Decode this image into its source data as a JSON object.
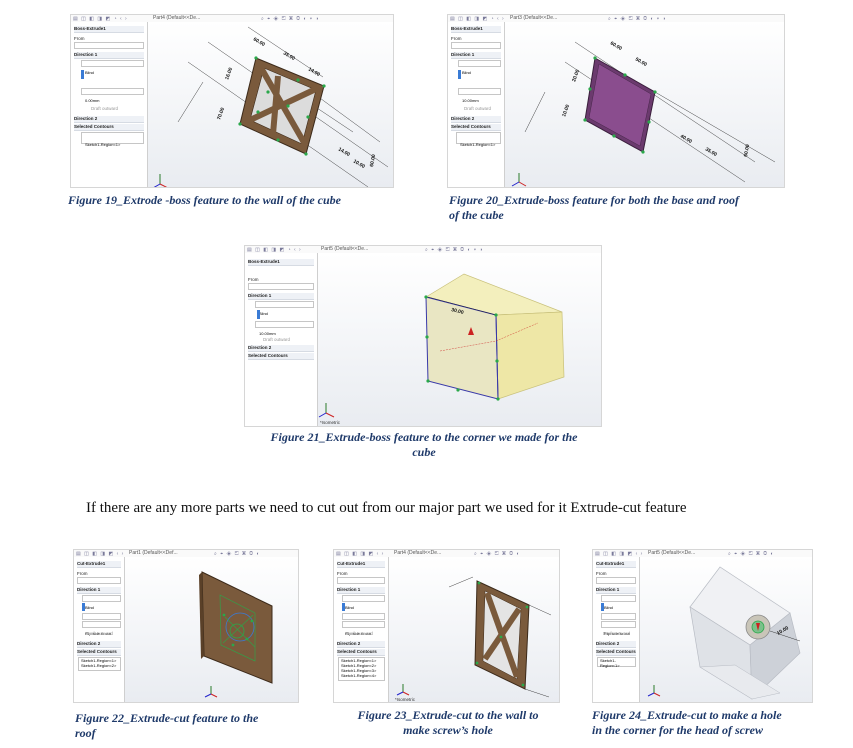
{
  "figures": {
    "f19": {
      "caption": "Figure 19_Extrode -boss feature to the wall of the cube",
      "window_title": "Part4 (Default<<De...",
      "panel_title": "Boss-Extrude1",
      "labels": [
        "From",
        "Sketch Plane",
        "Direction 1",
        "Blind",
        "0.00mm",
        "Draft outward",
        "Direction 2",
        "Selected Contours",
        "Sketch1-Region<1>"
      ],
      "dims": [
        "60.00",
        "35.00",
        "14.00",
        "16.00",
        "70.00",
        "60.00",
        "14.00",
        "10.00"
      ]
    },
    "f20": {
      "caption_line1": "Figure 20_Extrude-boss  feature for both the base and roof",
      "caption_line2": "of the cube",
      "window_title": "Part3 (Default<<De...",
      "panel_title": "Boss-Extrude1",
      "labels": [
        "From",
        "Sketch Plane",
        "Direction 1",
        "Blind",
        "10.00mm",
        "Draft outward",
        "Direction 2",
        "Selected Contours",
        "Sketch1-Region<1>"
      ],
      "dims": [
        "60.00",
        "50.00",
        "20.00",
        "10.00",
        "40.00",
        "35.00",
        "60.00"
      ]
    },
    "f21": {
      "caption_line1": "Figure 21_Extrude-boss  feature to the corner we made for the",
      "caption_line2": "cube",
      "window_title": "Part5 (Default<<De...",
      "panel_title": "Boss-Extrude1",
      "labels": [
        "From",
        "Sketch Plane",
        "Direction 1",
        "Blind",
        "10.00mm",
        "Draft outward",
        "Direction 2",
        "Selected Contours"
      ],
      "dims": [
        "30.00"
      ],
      "view_label": "*Isometric"
    },
    "f22": {
      "caption_line1": "Figure 22_Extrude-cut  feature to the",
      "caption_line2": "roof",
      "window_title": "Part1 (Default<<Def...",
      "panel_title": "Cut-Extrude1",
      "labels": [
        "From",
        "Sketch Plane",
        "Direction 1",
        "Blind",
        "5.00mm",
        "Flip side to cut",
        "Draft outward",
        "Direction 2",
        "Selected Contours",
        "Sketch1-Region<1>",
        "Sketch1-Region<2>"
      ]
    },
    "f23": {
      "caption_line1": "Figure 23_Extrude-cut to the wall to",
      "caption_line2": "make screw’s hole",
      "window_title": "Part4 (Default<<De...",
      "panel_title": "Cut-Extrude1",
      "labels": [
        "From",
        "Sketch Plane",
        "Direction 1",
        "Blind",
        "5.00mm",
        "Flip side to cut",
        "Draft outward",
        "Direction 2",
        "Selected Contours",
        "Sketch1-Region<1>",
        "Sketch1-Region<2>",
        "Sketch1-Region<3>",
        "Sketch1-Region<4>"
      ],
      "view_label": "*Isometric"
    },
    "f24": {
      "caption_line1": "Figure 24_Extrude-cut to make a hole",
      "caption_line2": "in the corner for the head of screw",
      "window_title": "Part5 (Default<<De...",
      "panel_title": "Cut-Extrude1",
      "labels": [
        "From",
        "Sketch Plane",
        "Direction 1",
        "Blind",
        "3.00mm",
        "Flip side to cut",
        "Draft outward",
        "Direction 2",
        "Selected Contours",
        "Sketch1-Region<1>"
      ],
      "dims": [
        "10.00"
      ]
    }
  },
  "paragraph": "If there are any more parts we need to cut out from our major part we used for it Extrude-cut feature",
  "colors": {
    "caption": "#1f3a6a",
    "wood": "#7a5a3c",
    "purple": "#6b3a6e",
    "cube_yellow": "#f3efbd",
    "dim_green": "#2aa84a"
  }
}
